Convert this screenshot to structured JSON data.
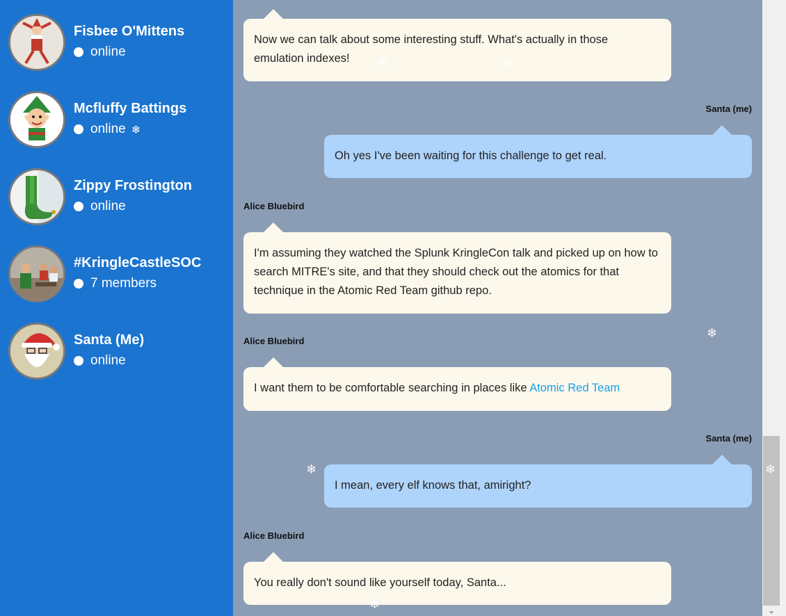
{
  "contacts": [
    {
      "name": "Fisbee O'Mittens",
      "status": "online"
    },
    {
      "name": "Mcfluffy Battings",
      "status": "online"
    },
    {
      "name": "Zippy Frostington",
      "status": "online"
    },
    {
      "name": "#KringleCastleSOC",
      "status": "7 members"
    },
    {
      "name": "Santa (Me)",
      "status": "online"
    }
  ],
  "messages": [
    {
      "sender": "",
      "text": "Now we can talk about some interesting stuff. What's actually in those emulation indexes!"
    },
    {
      "sender": "Santa (me)",
      "text": "Oh yes I've been waiting for this challenge to get real."
    },
    {
      "sender": "Alice Bluebird",
      "text": "I'm assuming they watched the Splunk KringleCon talk and picked up on how to search MITRE's site, and that they should check out the atomics for that technique in the Atomic Red Team github repo."
    },
    {
      "sender": "Alice Bluebird",
      "text": "I want them to be comfortable searching in places like ",
      "link": "Atomic Red Team"
    },
    {
      "sender": "Santa (me)",
      "text": "I mean, every elf knows that, amiright?"
    },
    {
      "sender": "Alice Bluebird",
      "text": "You really don't sound like yourself today, Santa..."
    }
  ],
  "snowflake": "❄",
  "colors": {
    "sidebar": "#1b74d0",
    "chat_bg": "#8a9db5",
    "incoming_bubble": "#fdf8ec",
    "outgoing_bubble": "#afd4fb",
    "link": "#1aa0e6"
  }
}
